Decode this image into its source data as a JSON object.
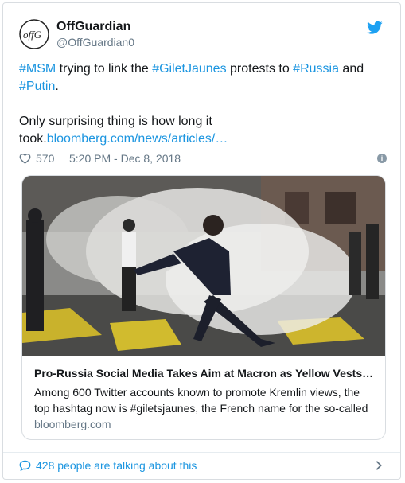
{
  "author": {
    "name": "OffGuardian",
    "handle": "@OffGuardian0",
    "avatar_text": "offG"
  },
  "tweet": {
    "line1": [
      {
        "text": "#MSM",
        "kind": "tag"
      },
      {
        "text": " trying to link the ",
        "kind": "plain"
      },
      {
        "text": "#GiletJaunes",
        "kind": "tag"
      },
      {
        "text": " protests to ",
        "kind": "plain"
      },
      {
        "text": "#Russia",
        "kind": "tag"
      },
      {
        "text": " and",
        "kind": "plain"
      }
    ],
    "line2_tag": "#Putin",
    "line2_rest": ".",
    "line3": "Only surprising thing is how long it",
    "line4_prefix": "took.",
    "line4_link": "bloomberg.com/news/articles/…"
  },
  "meta": {
    "likes": "570",
    "timestamp": "5:20 PM - Dec 8, 2018",
    "info_icon": "i"
  },
  "card": {
    "title": "Pro-Russia Social Media Takes Aim at Macron as Yellow Vests…",
    "description": "Among 600 Twitter accounts known to promote Kremlin views, the top hashtag now is #giletsjaunes, the French name for the so-called",
    "domain": "bloomberg.com"
  },
  "footer": {
    "talking": "428 people are talking about this"
  },
  "colors": {
    "link": "#1b95e0",
    "muted": "#657786",
    "border": "#d9dde1"
  },
  "icons": [
    "twitter-bird-icon",
    "heart-icon",
    "info-icon",
    "speech-bubble-icon",
    "chevron-right-icon"
  ]
}
